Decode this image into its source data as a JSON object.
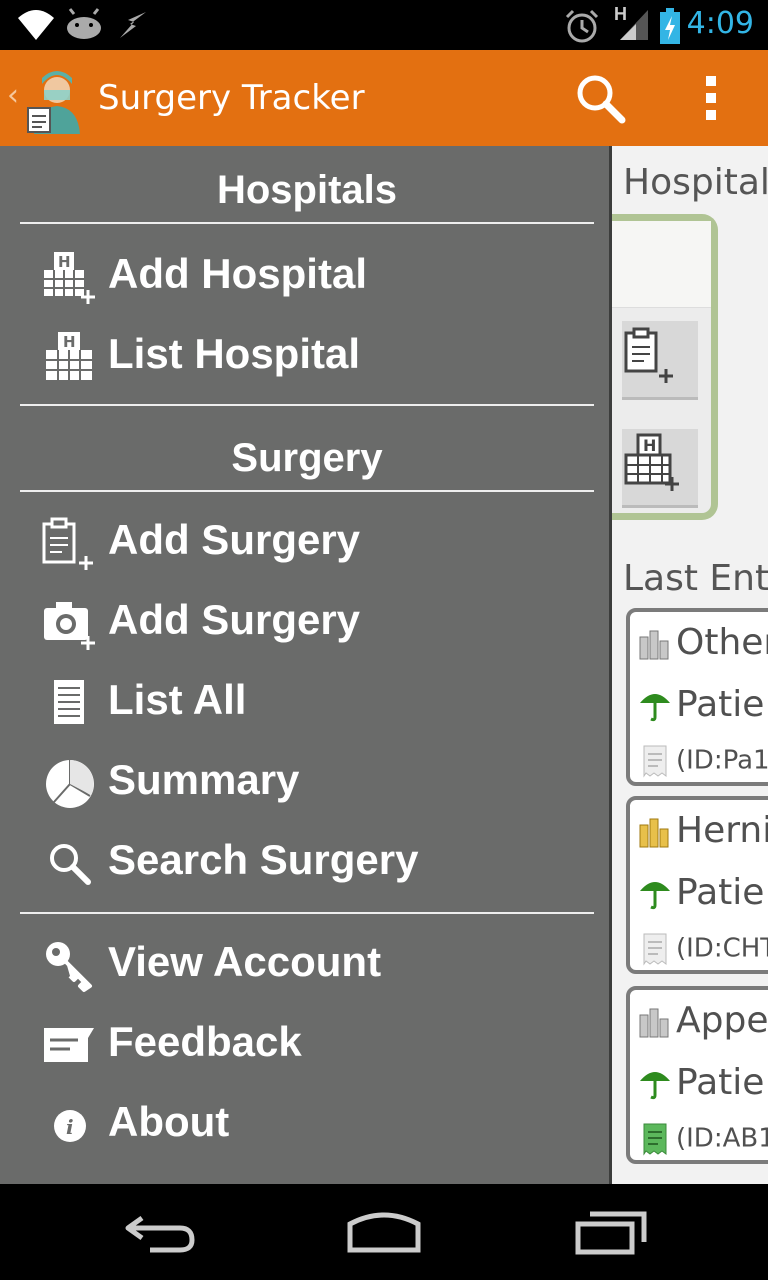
{
  "status_bar": {
    "time": "4:09",
    "network_label": "H",
    "icons": [
      "wifi-icon",
      "android-debug-icon",
      "usb-icon",
      "alarm-icon",
      "signal-icon",
      "battery-charging-icon"
    ]
  },
  "action_bar": {
    "title": "Surgery Tracker",
    "back_glyph": "‹",
    "icons": [
      "app-logo-icon",
      "search-icon",
      "overflow-menu-icon"
    ]
  },
  "drawer": {
    "hospitals_title": "Hospitals",
    "hospital_items": [
      {
        "label": "Add Hospital",
        "icon": "add-hospital-icon"
      },
      {
        "label": "List Hospital",
        "icon": "list-hospital-icon"
      }
    ],
    "surgery_title": "Surgery",
    "surgery_items": [
      {
        "label": "Add Surgery",
        "icon": "add-surgery-clipboard-icon"
      },
      {
        "label": "Add Surgery",
        "icon": "add-surgery-camera-icon"
      },
      {
        "label": "List All",
        "icon": "list-icon"
      },
      {
        "label": "Summary",
        "icon": "pie-chart-icon"
      },
      {
        "label": "Search Surgery",
        "icon": "search-icon"
      }
    ],
    "account_items": [
      {
        "label": "View Account",
        "icon": "key-icon"
      },
      {
        "label": "Feedback",
        "icon": "feedback-icon"
      },
      {
        "label": "About",
        "icon": "info-icon"
      }
    ]
  },
  "content": {
    "hospital_heading": "Hospital",
    "last_entries_heading": "Last Ent",
    "entries": [
      {
        "title": "Other",
        "patient": "Patie",
        "id": "(ID:Pa1",
        "fee_icon": "silver-coins-icon",
        "receipt_icon": "receipt-grey-icon"
      },
      {
        "title": "Herni",
        "patient": "Patie",
        "id": "(ID:CHT",
        "fee_icon": "gold-coins-icon",
        "receipt_icon": "receipt-grey-icon"
      },
      {
        "title": "Appe",
        "patient": "Patie",
        "id": "(ID:AB1",
        "fee_icon": "silver-coins-icon",
        "receipt_icon": "receipt-green-icon"
      }
    ]
  },
  "colors": {
    "action_bar": "#e37011",
    "drawer_bg": "#6a6b6a",
    "clock": "#33b5e5",
    "umbrella_green": "#2e8b1e"
  }
}
